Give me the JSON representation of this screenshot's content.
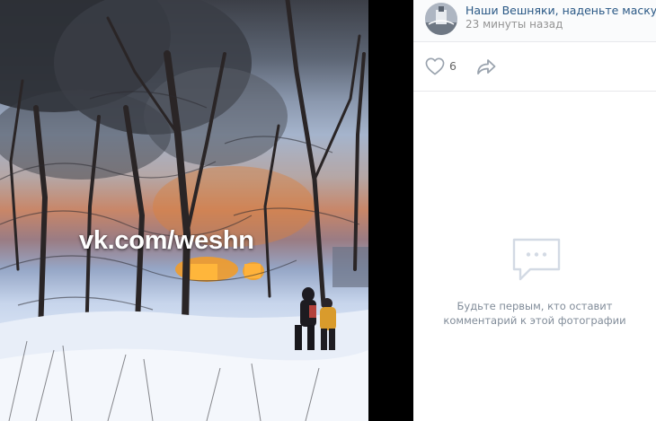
{
  "photo": {
    "watermark": "vk.com/weshn"
  },
  "post": {
    "author": "Наши Вешняки, наденьте маску",
    "time": "23 минуты назад",
    "likes": "6"
  },
  "comments": {
    "empty_line1": "Будьте первым, кто оставит",
    "empty_line2": "комментарий к этой фотографии"
  },
  "colors": {
    "link": "#2a5885",
    "muted": "#939393",
    "icon": "#99a2ad",
    "divider": "#e7e8ec"
  },
  "icons": {
    "like": "heart-outline-icon",
    "share": "share-arrow-icon",
    "empty_comments": "comment-bubble-icon"
  }
}
